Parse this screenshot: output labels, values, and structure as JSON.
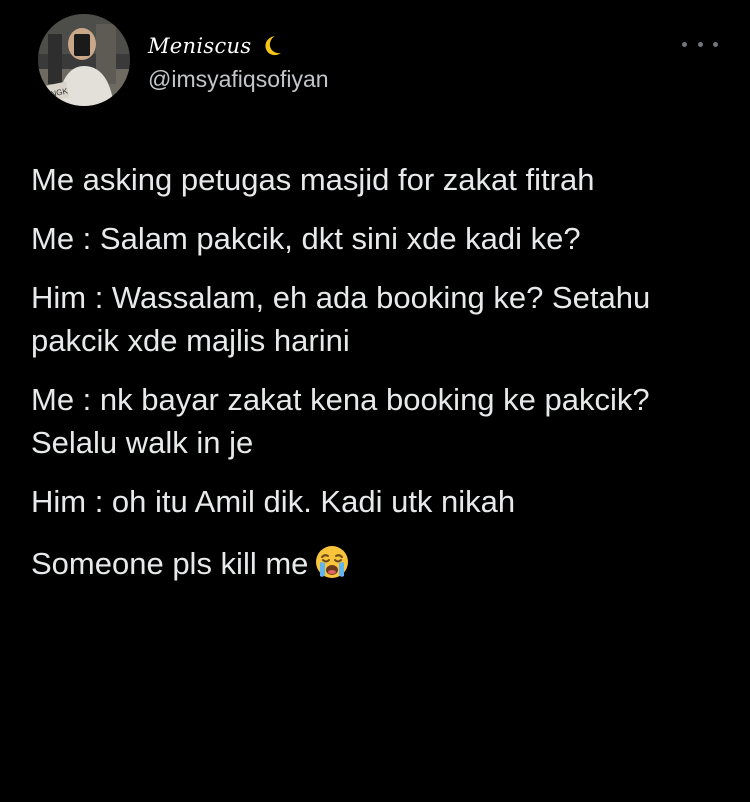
{
  "author": {
    "display_name": "Meniscus",
    "name_icon": "crescent-moon-icon",
    "handle": "@imsyafiqsofiyan",
    "avatar_icon": "profile-photo"
  },
  "header": {
    "more_icon": "more-options-icon"
  },
  "tweet": {
    "lines": [
      "Me asking petugas masjid for zakat fitrah",
      "Me : Salam pakcik, dkt sini xde kadi ke?",
      "Him : Wassalam, eh ada booking ke? Setahu pakcik xde majlis harini",
      "Me : nk bayar zakat kena booking ke pakcik? Selalu walk in je",
      "Him : oh itu Amil dik. Kadi utk nikah",
      "Someone pls kill me"
    ],
    "end_emoji": "loudly-crying-face-icon"
  },
  "colors": {
    "background": "#000000",
    "text": "#e7e9ea",
    "handle": "#c2c6ca",
    "icon_gray": "#71767b",
    "moon": "#f5c518"
  }
}
